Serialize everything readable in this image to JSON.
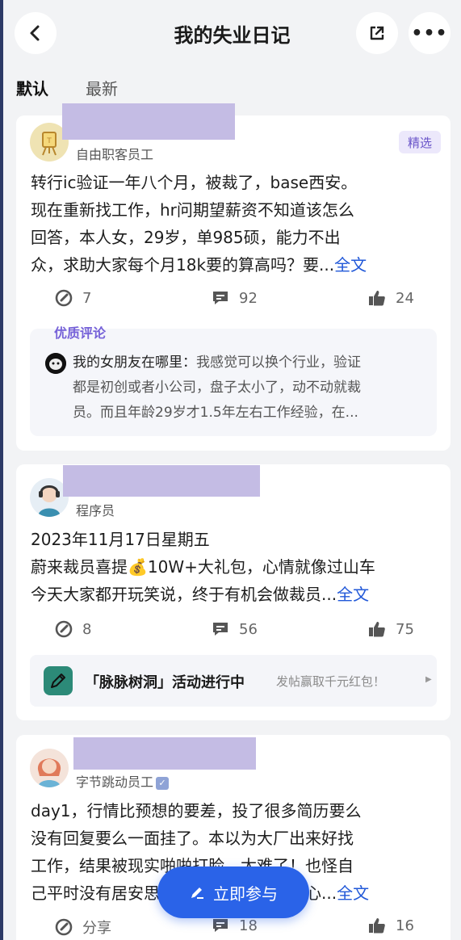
{
  "header": {
    "title": "我的失业日记",
    "back_icon": "‹",
    "more_icon": "•••"
  },
  "tabs": [
    {
      "label": "默认",
      "active": true
    },
    {
      "label": "最新",
      "active": false
    }
  ],
  "posts": [
    {
      "role": "自由职客员工",
      "badge": "精选",
      "lines": [
        "转行ic验证一年八个月，被裁了，base西安。",
        "现在重新找工作，hr问期望薪资不知道该怎么",
        "回答，本人女，29岁，单985硕，能力不出",
        "众，求助大家每个月18k要的算高吗？要..."
      ],
      "more": "全文",
      "stats": {
        "edit": "7",
        "comments": "92",
        "likes": "24"
      },
      "top_comment": {
        "title": "优质评论",
        "author": "我的女朋友在哪里：",
        "lines": [
          "我感觉可以换个行业，验证",
          "都是初创或者小公司，盘子太小了，动不动就裁",
          "员。而且年龄29岁才1.5年左右工作经验，在..."
        ]
      }
    },
    {
      "role": "程序员",
      "lines": [
        "2023年11月17日星期五",
        "蔚来裁员喜提💰10W+大礼包，心情就像过山车",
        "今天大家都开玩笑说，终于有机会做裁员..."
      ],
      "more": "全文",
      "stats": {
        "edit": "8",
        "comments": "56",
        "likes": "75"
      },
      "event": {
        "title": "「脉脉树洞」活动进行中",
        "subtitle": "发帖赢取千元红包！",
        "arrow": "▶"
      }
    },
    {
      "role": "字节跳动员工",
      "verified_mark": "✓",
      "lines": [
        "day1，行情比预想的要差，投了很多简历要么",
        "没有回复要么一面挂了。本以为大厂出来好找",
        "工作，结果被现实啪啪打脸。太难了！也怪自",
        "己平时没有居安思危，还是太心存侥幸心..."
      ],
      "more": "全文",
      "stats": {
        "edit": "分享",
        "comments": "18",
        "likes": "16"
      }
    }
  ],
  "fab": {
    "label": "立即参与"
  },
  "colors": {
    "accent": "#2a63e8",
    "link": "#2158d8",
    "purple": "#7561d8",
    "mask": "#c4bce4",
    "background": "#f2f3f5"
  }
}
